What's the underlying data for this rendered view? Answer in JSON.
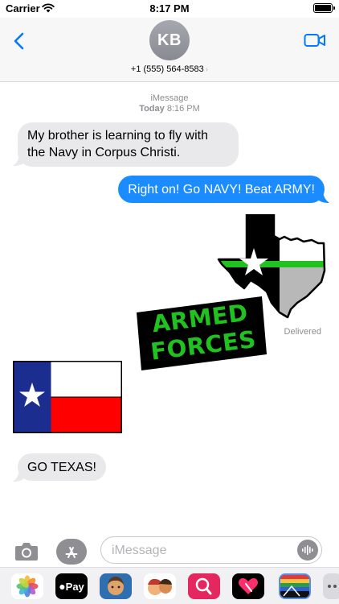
{
  "status_bar": {
    "carrier": "Carrier",
    "time": "8:17 PM"
  },
  "header": {
    "avatar_initials": "KB",
    "contact_number": "+1 (555) 564-8583",
    "contact_chevron": "›"
  },
  "thread": {
    "service": "iMessage",
    "timestamp_day": "Today",
    "timestamp_time": "8:16 PM",
    "messages": [
      {
        "direction": "incoming",
        "text": "My brother is learning to fly with the Navy in Corpus Christi."
      },
      {
        "direction": "outgoing",
        "text": "Right on! Go NAVY! Beat ARMY!"
      },
      {
        "direction": "incoming",
        "text": "GO TEXAS!"
      }
    ],
    "stickers": {
      "armed_forces_line1": "ARMED",
      "armed_forces_line2": "FORCES"
    },
    "delivered_label": "Delivered"
  },
  "composer": {
    "placeholder": "iMessage"
  },
  "app_drawer": {
    "apple_pay_label": "Pay"
  },
  "colors": {
    "outgoing_bubble": "#1a8cff",
    "incoming_bubble": "#e9e9eb",
    "accent": "#007aff",
    "sticker_green": "#1fc21f"
  },
  "icons": [
    "back-chevron-icon",
    "video-call-icon",
    "camera-icon",
    "app-store-icon",
    "audio-waveform-icon",
    "wifi-icon",
    "battery-icon"
  ]
}
